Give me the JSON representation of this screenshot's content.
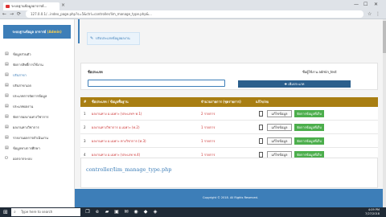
{
  "browser": {
    "tab_title": "ระบบฐานข้อมูลอาจารย์…",
    "url": "127.0.0.1/...index_page.php?s=5&ctrl=controller/lim_manage_type.php&...",
    "close": "×",
    "minimize": "—",
    "maximize": "☐",
    "winclose": "✕"
  },
  "sidebar": {
    "header_main": "ระบบฐานข้อมูล อาจารย์",
    "header_accent": "(Admin)",
    "items": [
      {
        "label": "ข้อมูลส่วนตัว",
        "icon": "▤"
      },
      {
        "label": "จัดการสิทธิ์การใช้งาน",
        "icon": "▤"
      },
      {
        "label": "ปรับสาขา",
        "icon": "▤"
      },
      {
        "label": "ปรับสาขาเอก",
        "icon": "▤"
      },
      {
        "label": "ประเภทการจัดการข้อมูล",
        "icon": "▤"
      },
      {
        "label": "ประเภทผลงาน",
        "icon": "▤"
      },
      {
        "label": "จัดการผลงานทางวิชาการ",
        "icon": "▤"
      },
      {
        "label": "ผลงานทางวิชาการ",
        "icon": "▤"
      },
      {
        "label": "รายงานผลการดำเนินงาน",
        "icon": "▤"
      },
      {
        "label": "ข้อมูลทางการศึกษา",
        "icon": "▤"
      },
      {
        "label": "ออกจากระบบ",
        "icon": "⏻"
      }
    ]
  },
  "breadcrumb": {
    "icon": "✎",
    "text": "ปรับประเภทข้อมูลผลงาน"
  },
  "panel": {
    "label": "ชื่อประเภท",
    "user_label": "ชื่อผู้ใช้งาน admin_test",
    "add_button": "✚ เพิ่มประเภท"
  },
  "table": {
    "headers": [
      "#",
      "ชื่อประเภท / ข้อมูลพื้นฐาน",
      "จำนวนรายการ (ชุดรายการ)",
      "แก้ไข/ลบ"
    ],
    "rows": [
      {
        "num": "1",
        "name": "ผลงานทาง อ.เฉพาะ (ประเภทฯ ท.1)",
        "count": "2 รายการ",
        "edit": "แก้ไขข้อมูล",
        "manage": "จัดการข้อมูลที่เก็บ"
      },
      {
        "num": "2",
        "name": "ผลงานทางวิชาการ อ.เฉพาะ (ท.2)",
        "count": "1 รายการ",
        "edit": "แก้ไขข้อมูล",
        "manage": "จัดการข้อมูลที่เก็บ"
      },
      {
        "num": "3",
        "name": "ผลงานทาง อ.เฉพาะ ทางวิชาการ (ท.3)",
        "count": "1 รายการ",
        "edit": "แก้ไขข้อมูล",
        "manage": "จัดการข้อมูลที่เก็บ"
      },
      {
        "num": "4",
        "name": "ผลงานทาง อ.เฉพาะ (ประเภท ท.4)",
        "count": "1 รายการ",
        "edit": "แก้ไขข้อมูล",
        "manage": "จัดการข้อมูลที่เก็บ"
      }
    ]
  },
  "controller_text": "controller/lim_manage_type.php",
  "footer": "Copyright © 2018. All Rights Reserved.",
  "taskbar": {
    "search": "Type here to search",
    "time": "4:09 PM",
    "date": "7/27/2018",
    "start": "⊞"
  }
}
